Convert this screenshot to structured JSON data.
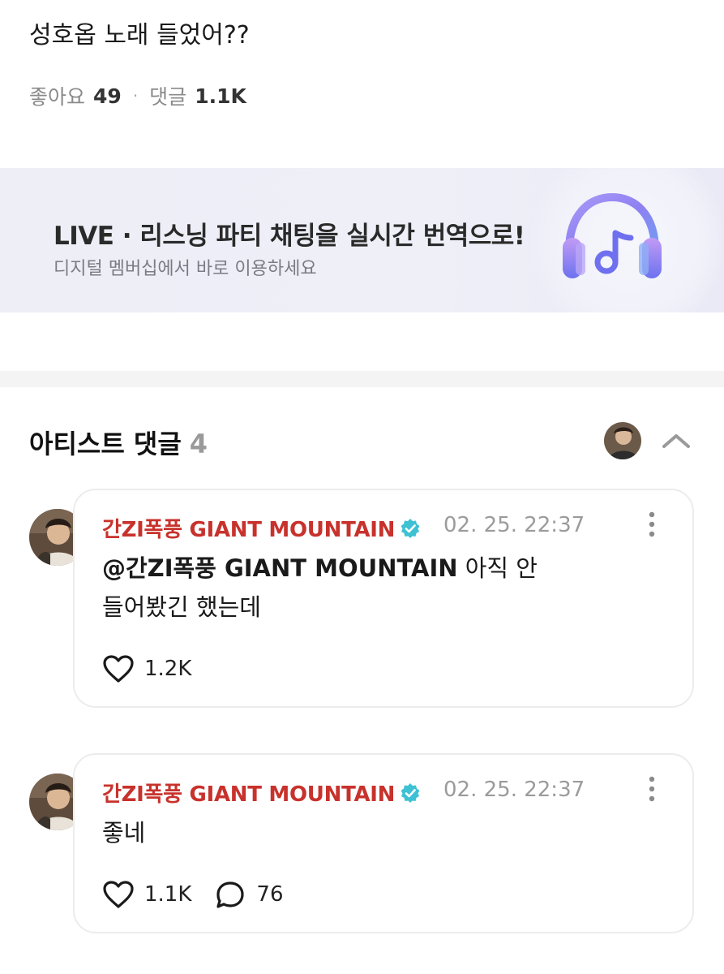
{
  "post": {
    "text": "성호옵 노래 들었어??",
    "likes_label": "좋아요",
    "likes_count": "49",
    "comments_label": "댓글",
    "comments_count": "1.1K"
  },
  "banner": {
    "title": "LIVE · 리스닝 파티 채팅을 실시간 번역으로!",
    "subtitle": "디지털 멤버십에서 바로 이용하세요",
    "colors": {
      "purple": "#8b6cf0",
      "blue": "#5a8ef0",
      "pink": "#c48ef0"
    }
  },
  "artist_comments": {
    "title": "아티스트 댓글",
    "count": "4"
  },
  "comments": [
    {
      "author": "간ZI폭풍 GIANT MOUNTAIN",
      "date": "02. 25. 22:37",
      "mention": "@간ZI폭풍 GIANT MOUNTAIN",
      "text_after_mention": " 아직 안",
      "text_line2": "들어봤긴 했는데",
      "likes": "1.2K"
    },
    {
      "author": "간ZI폭풍 GIANT MOUNTAIN",
      "date": "02. 25. 22:37",
      "text": "좋네",
      "likes": "1.1K",
      "replies": "76"
    }
  ],
  "colors": {
    "author": "#c8322c",
    "verified": "#3ec1d3",
    "muted": "#9b9b9b"
  }
}
